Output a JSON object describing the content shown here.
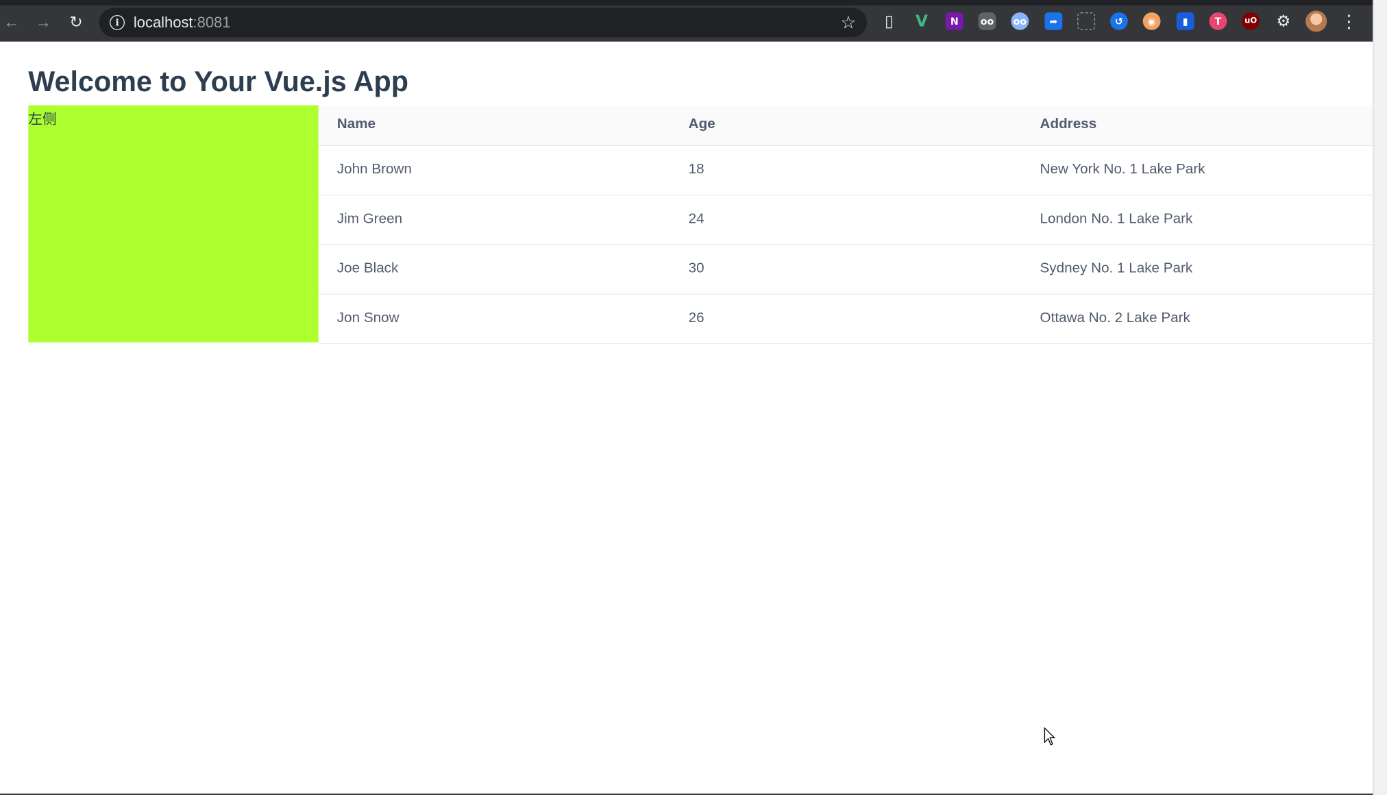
{
  "browser": {
    "url_host": "localhost",
    "url_port": ":8081"
  },
  "page": {
    "title": "Welcome to Your Vue.js App",
    "left_label": "左侧"
  },
  "table": {
    "columns": [
      "Name",
      "Age",
      "Address"
    ],
    "rows": [
      [
        "John Brown",
        "18",
        "New York No. 1 Lake Park"
      ],
      [
        "Jim Green",
        "24",
        "London No. 1 Lake Park"
      ],
      [
        "Joe Black",
        "30",
        "Sydney No. 1 Lake Park"
      ],
      [
        "Jon Snow",
        "26",
        "Ottawa No. 2 Lake Park"
      ]
    ]
  },
  "colors": {
    "left_panel": "#adff2f",
    "title": "#2c3e50",
    "table_text": "#515a6e"
  },
  "icons": [
    "back-arrow-icon",
    "forward-arrow-icon",
    "reload-icon",
    "info-icon",
    "star-icon",
    "bookmark-icon",
    "extensions-puzzle-icon",
    "kebab-menu-icon",
    "cursor-icon"
  ]
}
